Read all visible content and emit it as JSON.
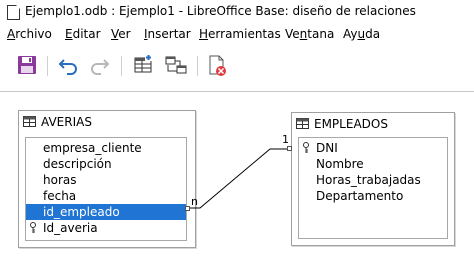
{
  "window": {
    "title": "Ejemplo1.odb : Ejemplo1 - LibreOffice Base: diseño de relaciones"
  },
  "menu": {
    "items": [
      {
        "pre": "",
        "u": "A",
        "post": "rchivo"
      },
      {
        "pre": "",
        "u": "E",
        "post": "ditar"
      },
      {
        "pre": "",
        "u": "V",
        "post": "er"
      },
      {
        "pre": "",
        "u": "I",
        "post": "nsertar"
      },
      {
        "pre": "",
        "u": "H",
        "post": "erramientas"
      },
      {
        "pre": "Ve",
        "u": "n",
        "post": "tana"
      },
      {
        "pre": "Ay",
        "u": "u",
        "post": "da"
      }
    ]
  },
  "toolbar": {
    "icons": [
      "save-icon",
      "undo-icon",
      "redo-icon",
      "add-tables-icon",
      "new-relation-icon",
      "close-edit-view-icon"
    ],
    "colors": {
      "save": "#8a3a9a",
      "undo": "#2a6fbe",
      "redo": "#b8b8b8",
      "close": "#e0393e"
    }
  },
  "tables": {
    "averias": {
      "name": "AVERIAS",
      "fields": [
        "empresa_cliente",
        "descripción",
        "horas",
        "fecha",
        "id_empleado",
        "Id_averia"
      ],
      "selected_field": "id_empleado",
      "key_field": "Id_averia"
    },
    "empleados": {
      "name": "EMPLEADOS",
      "fields": [
        "DNI",
        "Nombre",
        "Horas_trabajadas",
        "Departamento"
      ],
      "key_field": "DNI"
    }
  },
  "relation": {
    "from_cardinality": "n",
    "to_cardinality": "1"
  },
  "colors": {
    "selection": "#1f74d4",
    "border": "#a0a0a0"
  }
}
